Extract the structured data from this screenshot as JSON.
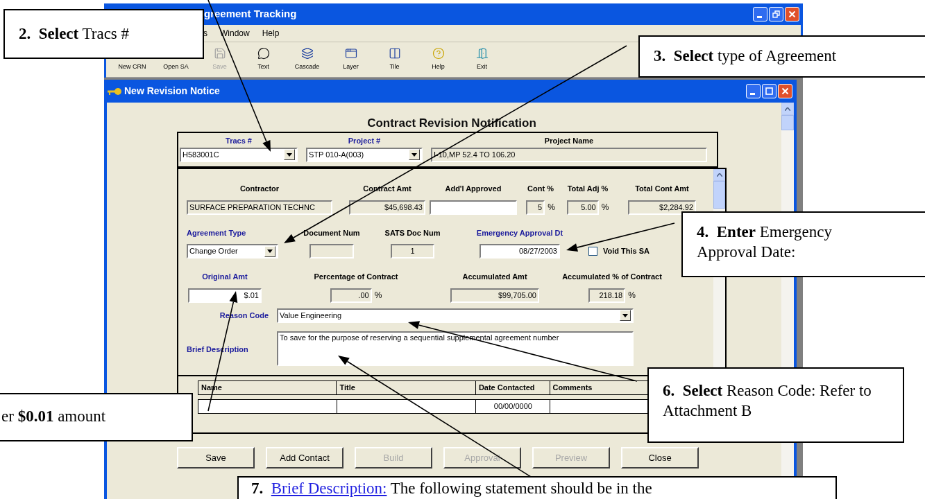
{
  "app_window": {
    "title": "greement Tracking",
    "menu": [
      "s",
      "Window",
      "Help"
    ],
    "toolbar": [
      {
        "label": "New CRN",
        "disabled": false
      },
      {
        "label": "Open SA",
        "disabled": false
      },
      {
        "label": "Save",
        "kind": "save",
        "disabled": true
      },
      {
        "label": "Text",
        "kind": "text",
        "disabled": false
      },
      {
        "label": "Cascade",
        "kind": "cascade",
        "disabled": false
      },
      {
        "label": "Layer",
        "kind": "layer",
        "disabled": false
      },
      {
        "label": "Tile",
        "kind": "tile",
        "disabled": false
      },
      {
        "label": "Help",
        "kind": "help",
        "disabled": false
      },
      {
        "label": "Exit",
        "kind": "exit",
        "disabled": false
      }
    ]
  },
  "form_window": {
    "title": "New Revision Notice",
    "heading": "Contract Revision Notification",
    "header": [
      {
        "label": "Tracs #",
        "required": true,
        "value": "H583001C",
        "kind": "select",
        "editable": true
      },
      {
        "label": "Project #",
        "required": true,
        "value": "STP 010-A(003)",
        "kind": "select",
        "editable": true
      },
      {
        "label": "Project Name",
        "required": false,
        "value": "I-10,MP 52.4 TO 106.20",
        "kind": "text",
        "editable": false
      }
    ],
    "field_groups": [
      [
        {
          "label": "Contractor",
          "required": false,
          "value": "SURFACE PREPARATION TECHNC",
          "kind": "text",
          "editable": false
        },
        {
          "label": "Contract  Amt",
          "required": false,
          "value": "$45,698.43",
          "kind": "amount",
          "editable": false
        },
        {
          "label": "Add'l Approved",
          "required": false,
          "kind": "amount",
          "editable": true
        },
        {
          "label": "Cont %",
          "required": false,
          "value": "5",
          "unit": "%",
          "kind": "amount",
          "editable": false
        },
        {
          "label": "Total Adj %",
          "required": false,
          "value": "5.00",
          "unit": "%",
          "kind": "amount",
          "editable": false
        },
        {
          "label": "Total Cont Amt",
          "required": false,
          "value": "$2,284.92",
          "kind": "amount",
          "editable": false
        }
      ],
      [
        {
          "label": "Agreement Type",
          "required": true,
          "value": "Change Order",
          "kind": "select",
          "editable": true
        },
        {
          "label": "Document Num",
          "required": false,
          "kind": "text",
          "editable": false
        },
        {
          "label": "SATS Doc Num",
          "required": false,
          "value": "1",
          "kind": "center",
          "editable": false
        },
        {
          "label": "Emergency Approval Dt",
          "required": true,
          "value": "08/27/2003",
          "kind": "amount",
          "editable": true
        },
        {
          "label": "Void This SA",
          "kind": "check",
          "checked": false
        }
      ],
      [
        {
          "label": "Original Amt",
          "required": true,
          "value": "$.01",
          "kind": "amount",
          "editable": true
        },
        {
          "label": "Percentage of Contract",
          "required": false,
          "value": ".00",
          "unit": "%",
          "kind": "amount",
          "editable": false
        },
        {
          "label": "Accumulated Amt",
          "required": false,
          "value": "$99,705.00",
          "kind": "amount",
          "editable": false
        },
        {
          "label": "Accumulated % of Contract",
          "required": false,
          "value": "218.18",
          "unit": "%",
          "kind": "amount",
          "editable": false
        }
      ]
    ],
    "reason_code": {
      "label": "Reason Code",
      "required": true,
      "value": "Value Engineering"
    },
    "brief_description": {
      "label": "Brief Description",
      "required": true,
      "value": "To save for the purpose of reserving a sequential supplemental agreement number"
    },
    "contacts": {
      "columns": [
        "Name",
        "Title",
        "Date Contacted",
        "Comments"
      ],
      "rows": [
        [
          "",
          "",
          "00/00/0000",
          ""
        ]
      ]
    },
    "buttons": [
      {
        "label": "Save",
        "disabled": false
      },
      {
        "label": "Add Contact",
        "disabled": false
      },
      {
        "label": "Build",
        "disabled": true
      },
      {
        "label": "Approval",
        "disabled": true
      },
      {
        "label": "Preview",
        "disabled": true
      },
      {
        "label": "Close",
        "disabled": false
      }
    ]
  },
  "callouts": [
    {
      "number": "2.",
      "text": "**Select** Tracs #"
    },
    {
      "number": "3.",
      "text": "**Select** type of Agreement"
    },
    {
      "number": "4.",
      "text": "**Enter** Emergency Approval Date:"
    },
    {
      "text": "er **$0.01** amount"
    },
    {
      "number": "6.",
      "text": "**Select** Reason Code: Refer to Attachment B"
    },
    {
      "number": "7.",
      "link": "Brief Description:",
      "text": "The following statement should be in the"
    }
  ]
}
